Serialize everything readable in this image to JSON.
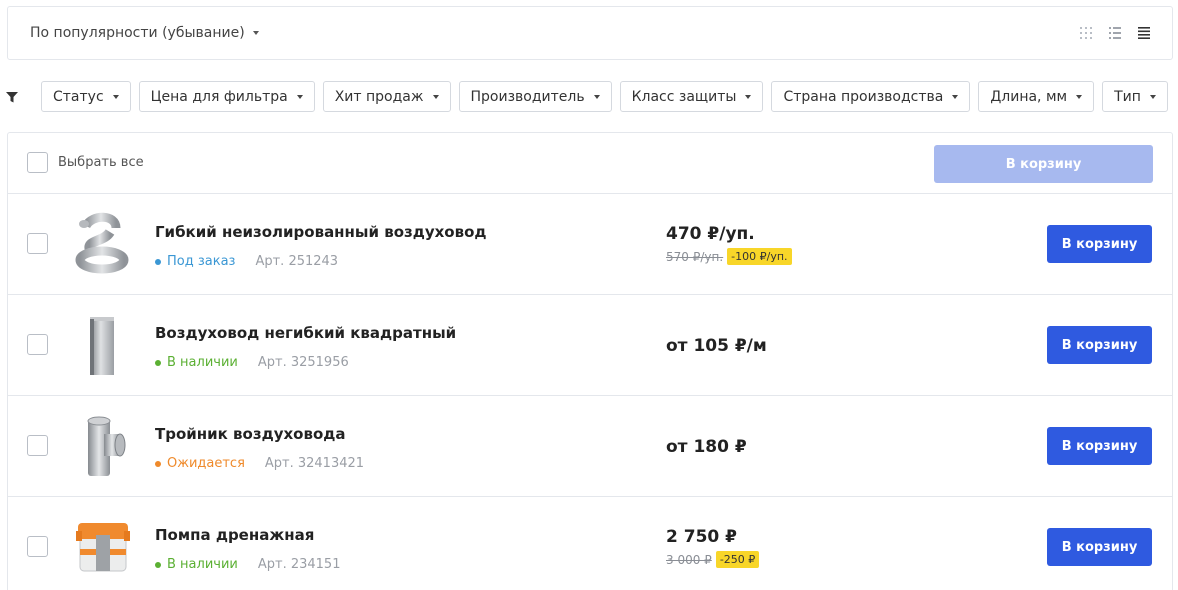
{
  "sort": {
    "label": "По популярности (убывание)"
  },
  "view_modes": [
    "grid-view-icon",
    "list-view-icon",
    "table-view-icon"
  ],
  "filters": [
    "Статус",
    "Цена для фильтра",
    "Хит продаж",
    "Производитель",
    "Класс защиты",
    "Страна производства",
    "Длина, мм",
    "Тип"
  ],
  "select_all": {
    "label": "Выбрать все",
    "button": "В корзину"
  },
  "colors": {
    "accent": "#2f5ae0",
    "accent_disabled": "#a7b9ef",
    "status_order": "#3a97d4",
    "status_in_stock": "#5bb033",
    "status_expected": "#ef8a2b",
    "discount_badge": "#f8d629"
  },
  "products": [
    {
      "name": "Гибкий неизолированный воздуховод",
      "status": "Под заказ",
      "sku": "Арт. 251243",
      "price": "470 ₽/уп.",
      "old_price": "570 ₽/уп.",
      "discount": "-100 ₽/уп.",
      "button": "В корзину"
    },
    {
      "name": "Воздуховод негибкий квадратный",
      "status": "В наличии",
      "sku": "Арт. 3251956",
      "price": "от 105 ₽/м",
      "button": "В корзину"
    },
    {
      "name": "Тройник воздуховода",
      "status": "Ожидается",
      "sku": "Арт. 32413421",
      "price": "от 180 ₽",
      "button": "В корзину"
    },
    {
      "name": "Помпа дренажная",
      "status": "В наличии",
      "sku": "Арт. 234151",
      "price": "2 750 ₽",
      "old_price": "3 000 ₽",
      "discount": "-250 ₽",
      "button": "В корзину"
    }
  ]
}
